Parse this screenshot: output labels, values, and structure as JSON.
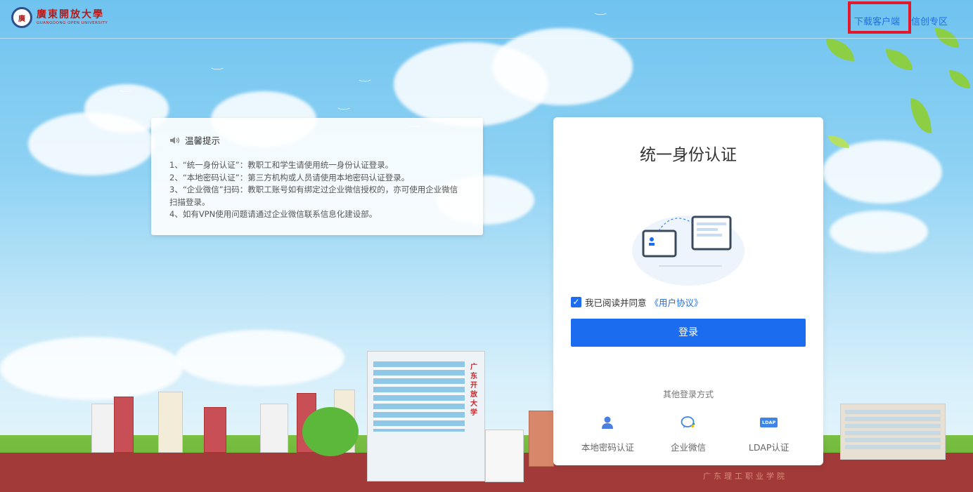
{
  "header": {
    "logo_cn": "廣東開放大學",
    "logo_en": "GUANGDONG OPEN UNIVERSITY",
    "links": [
      "下载客户端",
      "信创专区"
    ]
  },
  "tips": {
    "title": "温馨提示",
    "lines": [
      "1、“统一身份认证”：教职工和学生请使用统一身份认证登录。",
      "2、“本地密码认证”：第三方机构或人员请使用本地密码认证登录。",
      "3、“企业微信”扫码：教职工账号如有绑定过企业微信授权的，亦可使用企业微信扫描登录。",
      "4、如有VPN使用问题请通过企业微信联系信息化建设部。"
    ]
  },
  "login": {
    "title": "统一身份认证",
    "agree_text": "我已阅读并同意",
    "agree_link": "《用户协议》",
    "button": "登录",
    "other_label": "其他登录方式",
    "methods": [
      {
        "label": "本地密码认证",
        "icon": "user-icon"
      },
      {
        "label": "企业微信",
        "icon": "wecom-icon"
      },
      {
        "label": "LDAP认证",
        "icon": "ldap-icon"
      }
    ],
    "ldap_badge": "LDAP"
  },
  "scenery": {
    "building_sign": "广东开放大学",
    "wall_text": "广东理工职业学院"
  },
  "colors": {
    "accent": "#1c6cf0",
    "highlight_box": "#e2192b",
    "logo_red": "#b31b1b"
  }
}
